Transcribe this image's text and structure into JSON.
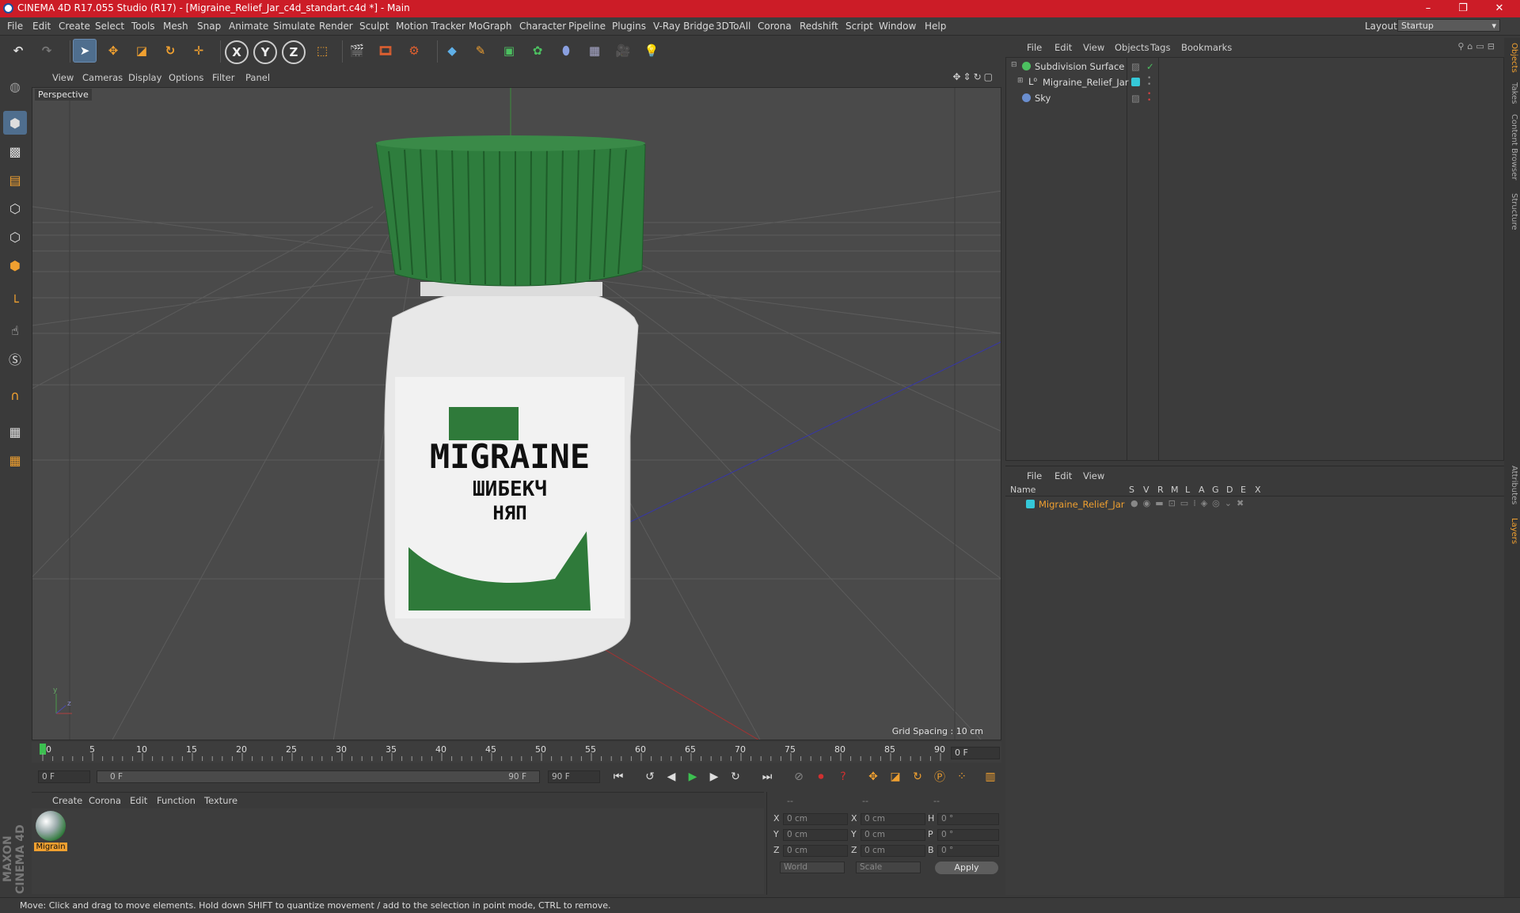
{
  "window": {
    "title": "CINEMA 4D R17.055 Studio (R17) - [Migraine_Relief_Jar_c4d_standart.c4d *] - Main",
    "minimize": "–",
    "restore": "❐",
    "close": "✕"
  },
  "menubar": {
    "items": [
      "File",
      "Edit",
      "Create",
      "Select",
      "Tools",
      "Mesh",
      "Snap",
      "Animate",
      "Simulate",
      "Render",
      "Sculpt",
      "Motion Tracker",
      "MoGraph",
      "Character",
      "Pipeline",
      "Plugins",
      "V-Ray Bridge",
      "3DToAll",
      "Corona",
      "Redshift",
      "Script",
      "Window",
      "Help"
    ],
    "layout_label": "Layout:",
    "layout_value": "Startup"
  },
  "toolbar": {
    "axis_x": "X",
    "axis_y": "Y",
    "axis_z": "Z"
  },
  "viewport": {
    "menu": [
      "View",
      "Cameras",
      "Display",
      "Options",
      "Filter",
      "Panel"
    ],
    "label": "Perspective",
    "grid_spacing": "Grid Spacing : 10 cm",
    "jar_label_line1": "MIGRAINE",
    "jar_label_line2": "ШИБЕКЧ",
    "jar_label_line3": "НЯП"
  },
  "timeline": {
    "ticks": [
      "0",
      "5",
      "10",
      "15",
      "20",
      "25",
      "30",
      "35",
      "40",
      "45",
      "50",
      "55",
      "60",
      "65",
      "70",
      "75",
      "80",
      "85",
      "90"
    ],
    "current_frame": "0 F",
    "start_field": "0 F",
    "range_start": "0 F",
    "range_end": "90 F",
    "end_field": "90 F"
  },
  "material_manager": {
    "menu": [
      "Create",
      "Corona",
      "Edit",
      "Function",
      "Texture"
    ],
    "material_name": "Migrain"
  },
  "coordinates": {
    "header": [
      "--",
      "--",
      "--"
    ],
    "rows": [
      {
        "l1": "X",
        "v1": "0 cm",
        "l2": "X",
        "v2": "0 cm",
        "l3": "H",
        "v3": "0 °"
      },
      {
        "l1": "Y",
        "v1": "0 cm",
        "l2": "Y",
        "v2": "0 cm",
        "l3": "P",
        "v3": "0 °"
      },
      {
        "l1": "Z",
        "v1": "0 cm",
        "l2": "Z",
        "v2": "0 cm",
        "l3": "B",
        "v3": "0 °"
      }
    ],
    "world": "World",
    "scale": "Scale",
    "apply": "Apply"
  },
  "object_manager": {
    "menu": [
      "File",
      "Edit",
      "View",
      "Objects",
      "Tags",
      "Bookmarks"
    ],
    "objects": [
      "Subdivision Surface",
      "Migraine_Relief_Jar",
      "Sky"
    ]
  },
  "layer_manager": {
    "menu": [
      "File",
      "Edit",
      "View"
    ],
    "columns": [
      "Name",
      "S",
      "V",
      "R",
      "M",
      "L",
      "A",
      "G",
      "D",
      "E",
      "X"
    ],
    "layer_name": "Migraine_Relief_Jar"
  },
  "side_tabs": [
    "Objects",
    "Takes",
    "Content Browser",
    "Structure",
    "Attributes",
    "Layers"
  ],
  "status": "Move: Click and drag to move elements. Hold down SHIFT to quantize movement / add to the selection in point mode, CTRL to remove.",
  "brand": "MAXON CINEMA 4D",
  "colors": {
    "accent": "#cc1c27",
    "selected_object": "#f0a030",
    "layer_color": "#35c8d8"
  }
}
